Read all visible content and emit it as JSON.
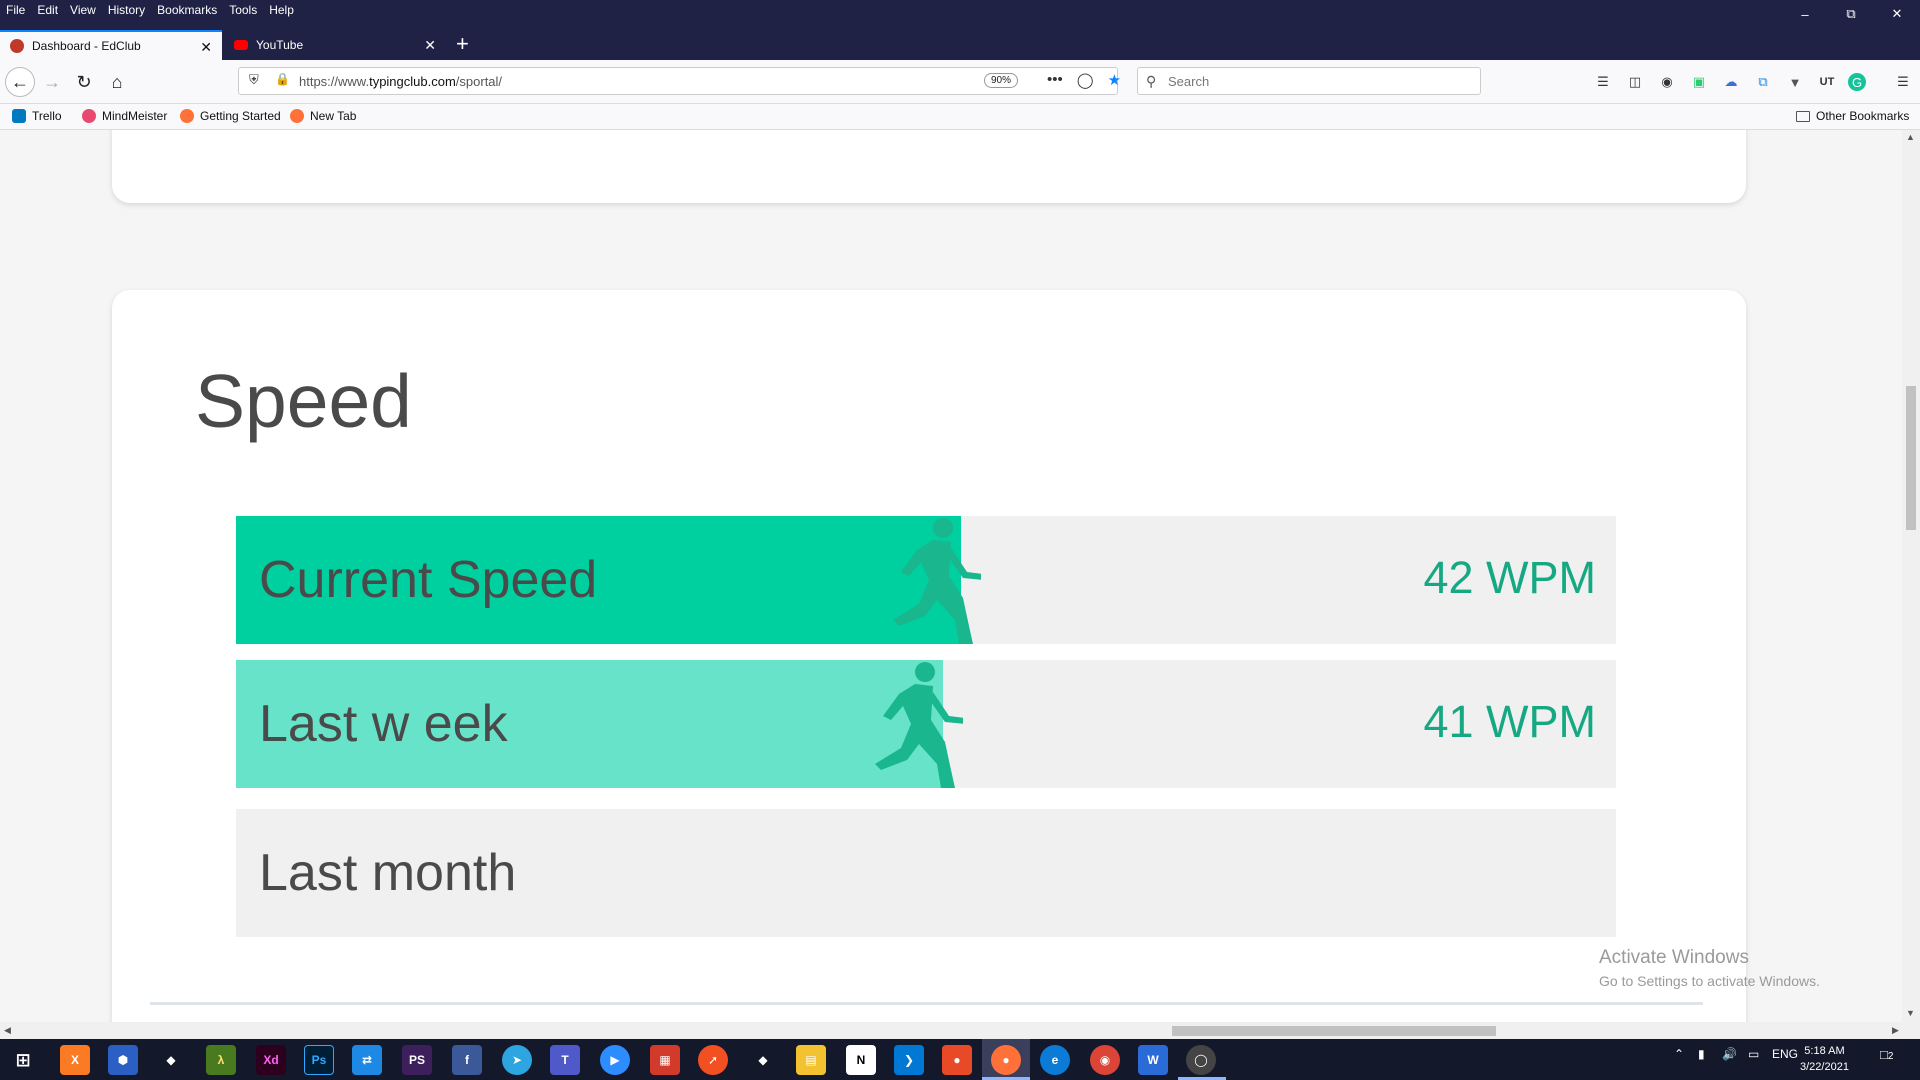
{
  "browser": {
    "menu": [
      "File",
      "Edit",
      "View",
      "History",
      "Bookmarks",
      "Tools",
      "Help"
    ],
    "tabs": [
      {
        "title": "Dashboard - EdClub",
        "active": true
      },
      {
        "title": "YouTube",
        "active": false
      }
    ],
    "url_prefix": "https://www.",
    "url_domain": "typingclub.com",
    "url_path": "/sportal/",
    "zoom": "90%",
    "search_placeholder": "Search",
    "bookmarks": [
      "Trello",
      "MindMeister",
      "Getting Started",
      "New Tab"
    ],
    "other_bookmarks": "Other Bookmarks"
  },
  "page": {
    "speed_title": "Speed",
    "rows": [
      {
        "label": "Current Speed",
        "value": "42 WPM",
        "fill_percent": 52.5,
        "color": "#00cfa0"
      },
      {
        "label": "Last w eek",
        "value": "41 WPM",
        "fill_percent": 51.2,
        "color": "#66e3c9"
      },
      {
        "label": "Last month",
        "value": "",
        "fill_percent": 0,
        "color": "#00cfa0"
      }
    ],
    "accent_color": "#15a883",
    "watermark_line1": "Activate Windows",
    "watermark_line2": "Go to Settings to activate Windows."
  },
  "taskbar": {
    "lang": "ENG",
    "time": "5:18 AM",
    "date": "3/22/2021",
    "notifications": "2"
  }
}
